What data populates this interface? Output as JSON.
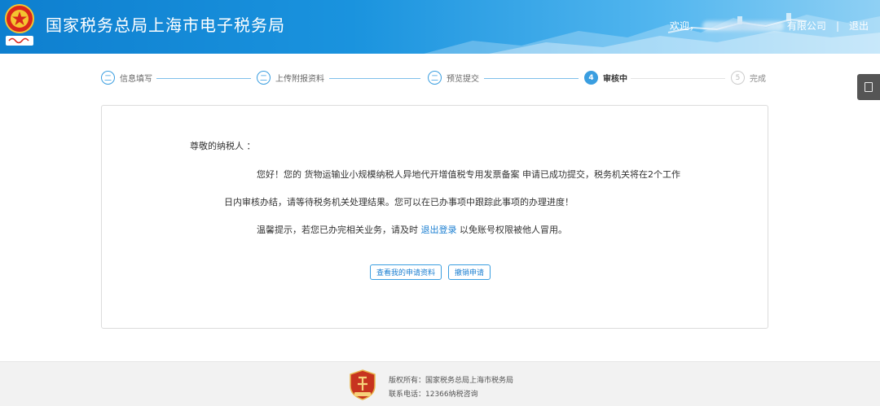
{
  "header": {
    "title": "国家税务总局上海市电子税务局",
    "welcome": "欢迎，",
    "company_suffix": "有限公司",
    "separator": "|",
    "logout": "退出"
  },
  "stepper": {
    "steps": [
      {
        "num": "二",
        "label": "信息填写",
        "state": "done"
      },
      {
        "num": "二",
        "label": "上传附报资料",
        "state": "done"
      },
      {
        "num": "二",
        "label": "预览提交",
        "state": "done"
      },
      {
        "num": "4",
        "label": "审核中",
        "state": "active"
      },
      {
        "num": "5",
        "label": "完成",
        "state": "todo"
      }
    ]
  },
  "content": {
    "greeting": "尊敬的纳税人 ：",
    "para1": "您好！您的 货物运输业小规模纳税人异地代开增值税专用发票备案 申请已成功提交，税务机关将在2个工作",
    "para2": "日内审核办结，请等待税务机关处理结果。您可以在已办事项中跟踪此事项的办理进度！",
    "para3_prefix": "温馨提示，若您已办完相关业务，请及时 ",
    "para3_link": "退出登录",
    "para3_suffix": " 以免账号权限被他人冒用。",
    "btn_view": "查看我的申请资料",
    "btn_revoke": "撤销申请"
  },
  "footer": {
    "copyright": "版权所有：国家税务总局上海市税务局",
    "contact": "联系电话：12366纳税咨询"
  },
  "colors": {
    "accent": "#3a9ee0",
    "link": "#1a7ed1",
    "header_start": "#0e7fcf"
  }
}
